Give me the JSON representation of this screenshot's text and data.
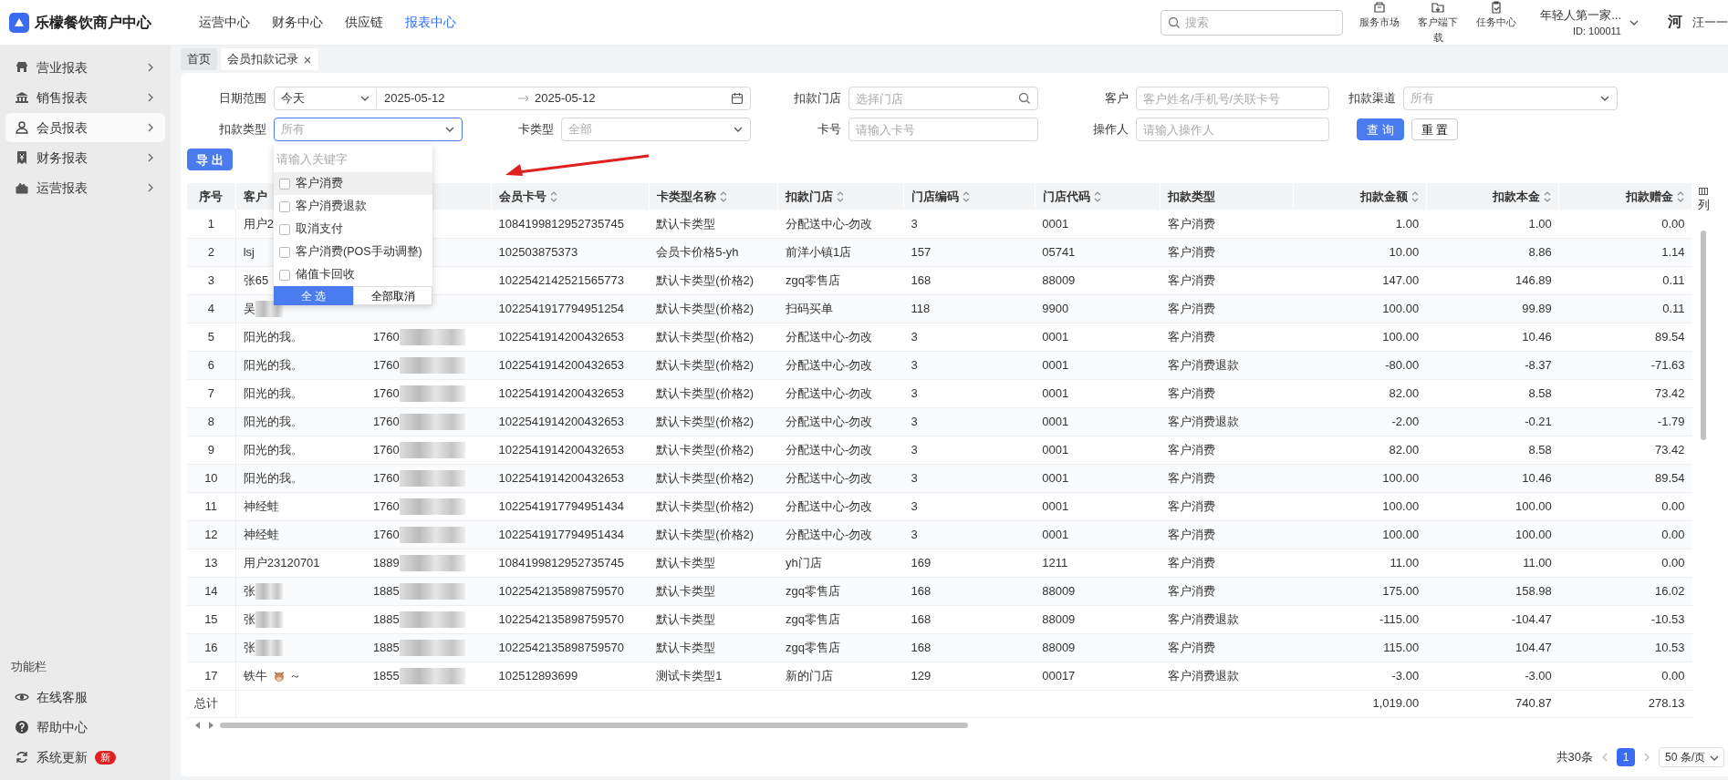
{
  "header": {
    "brand": "乐檬餐饮商户中心",
    "menu": [
      {
        "label": "运营中心",
        "selected": false
      },
      {
        "label": "财务中心",
        "selected": false
      },
      {
        "label": "供应链",
        "selected": false
      },
      {
        "label": "报表中心",
        "selected": true
      }
    ],
    "search": {
      "placeholder": "搜索"
    },
    "tools": [
      {
        "kind": "shop",
        "label": "服务市场"
      },
      {
        "kind": "download",
        "label": "客户端下载"
      },
      {
        "kind": "task",
        "label": "任务中心"
      }
    ],
    "account": {
      "name": "年轻人第一家...",
      "id": "ID: 100011"
    },
    "user": {
      "avatar": "河",
      "name": "汪一一"
    }
  },
  "sidebar": {
    "items": [
      {
        "kind": "store",
        "label": "营业报表",
        "selected": false
      },
      {
        "kind": "bank",
        "label": "销售报表",
        "selected": false
      },
      {
        "kind": "person",
        "label": "会员报表",
        "selected": true
      },
      {
        "kind": "receipt",
        "label": "财务报表",
        "selected": false
      },
      {
        "kind": "box",
        "label": "运营报表",
        "selected": false
      }
    ],
    "footer_title": "功能栏",
    "footer_items": [
      {
        "kind": "service",
        "label": "在线客服"
      },
      {
        "kind": "help",
        "label": "帮助中心"
      },
      {
        "kind": "update",
        "label": "系统更新",
        "badge": "新"
      }
    ]
  },
  "tabs": [
    {
      "label": "首页",
      "selected": false,
      "closable": false
    },
    {
      "label": "会员扣款记录",
      "selected": true,
      "closable": true
    }
  ],
  "filters": [
    {
      "kind": "date-range",
      "label": "日期范围",
      "preset": "今天",
      "start": "2025-05-12",
      "end": "2025-05-12"
    },
    {
      "kind": "search",
      "label": "扣款门店",
      "placeholder": "选择门店"
    },
    {
      "kind": "input",
      "label": "客户",
      "placeholder": "客户姓名/手机号/关联卡号"
    },
    {
      "kind": "select",
      "label": "扣款渠道",
      "placeholder": "所有",
      "open": false
    },
    {
      "kind": "select",
      "label": "扣款类型",
      "placeholder": "所有",
      "open": true
    },
    {
      "kind": "select",
      "label": "卡类型",
      "placeholder": "全部",
      "open": false
    },
    {
      "kind": "input",
      "label": "卡号",
      "placeholder": "请输入卡号"
    },
    {
      "kind": "input",
      "label": "操作人",
      "placeholder": "请输入操作人"
    }
  ],
  "query_buttons": [
    {
      "label": "查 询",
      "primary": true
    },
    {
      "label": "重 置",
      "primary": false
    }
  ],
  "dropdown": {
    "search_placeholder": "请输入关键字",
    "options": [
      {
        "label": "客户消费",
        "checked": false,
        "highlighted": true
      },
      {
        "label": "客户消费退款",
        "checked": false,
        "highlighted": false
      },
      {
        "label": "取消支付",
        "checked": false,
        "highlighted": false
      },
      {
        "label": "客户消费(POS手动调整)",
        "checked": false,
        "highlighted": false
      },
      {
        "label": "储值卡回收",
        "checked": false,
        "highlighted": false
      }
    ],
    "select_all": "全 选",
    "clear_all": "全部取消"
  },
  "export_button": "导 出",
  "table": {
    "columns": [
      {
        "label": "序号",
        "sortable": false
      },
      {
        "label": "客户",
        "sortable": false
      },
      null,
      {
        "label": "会员卡号",
        "sortable": true
      },
      {
        "label": "卡类型名称",
        "sortable": true
      },
      {
        "label": "扣款门店",
        "sortable": true
      },
      {
        "label": "门店编码",
        "sortable": true
      },
      {
        "label": "门店代码",
        "sortable": true
      },
      {
        "label": "扣款类型",
        "sortable": false
      },
      {
        "label": "扣款金额",
        "sortable": true
      },
      {
        "label": "扣款本金",
        "sortable": true
      },
      {
        "label": "扣款赠金",
        "sortable": true
      }
    ],
    "rows": [
      {
        "cells": [
          "1",
          "用户2",
          null,
          "1084199812952735745",
          "默认卡类型",
          "分配送中心-勿改",
          "3",
          "0001",
          "客户消费",
          "1.00",
          "1.00",
          "0.00"
        ]
      },
      {
        "cells": [
          "2",
          "lsj",
          null,
          "102503875373",
          "会员卡价格5-yh",
          "前洋小镇1店",
          "157",
          "05741",
          "客户消费",
          "10.00",
          "8.86",
          "1.14"
        ]
      },
      {
        "cells": [
          "3",
          "张65",
          null,
          "1022542142521565773",
          "默认卡类型(价格2)",
          "zgq零售店",
          "168",
          "88009",
          "客户消费",
          "147.00",
          "146.89",
          "0.11"
        ]
      },
      {
        "cells": [
          "4",
          "吴",
          null,
          "1022541917794951254",
          "默认卡类型(价格2)",
          "扫码买单",
          "118",
          "9900",
          "客户消费",
          "100.00",
          "99.89",
          "0.11"
        ],
        "name_blurred": true
      },
      {
        "cells": [
          "5",
          "阳光的我。",
          "1760",
          "1022541914200432653",
          "默认卡类型(价格2)",
          "分配送中心-勿改",
          "3",
          "0001",
          "客户消费",
          "100.00",
          "10.46",
          "89.54"
        ]
      },
      {
        "cells": [
          "6",
          "阳光的我。",
          "1760",
          "1022541914200432653",
          "默认卡类型(价格2)",
          "分配送中心-勿改",
          "3",
          "0001",
          "客户消费退款",
          "-80.00",
          "-8.37",
          "-71.63"
        ]
      },
      {
        "cells": [
          "7",
          "阳光的我。",
          "1760",
          "1022541914200432653",
          "默认卡类型(价格2)",
          "分配送中心-勿改",
          "3",
          "0001",
          "客户消费",
          "82.00",
          "8.58",
          "73.42"
        ]
      },
      {
        "cells": [
          "8",
          "阳光的我。",
          "1760",
          "1022541914200432653",
          "默认卡类型(价格2)",
          "分配送中心-勿改",
          "3",
          "0001",
          "客户消费退款",
          "-2.00",
          "-0.21",
          "-1.79"
        ]
      },
      {
        "cells": [
          "9",
          "阳光的我。",
          "1760",
          "1022541914200432653",
          "默认卡类型(价格2)",
          "分配送中心-勿改",
          "3",
          "0001",
          "客户消费",
          "82.00",
          "8.58",
          "73.42"
        ]
      },
      {
        "cells": [
          "10",
          "阳光的我。",
          "1760",
          "1022541914200432653",
          "默认卡类型(价格2)",
          "分配送中心-勿改",
          "3",
          "0001",
          "客户消费",
          "100.00",
          "10.46",
          "89.54"
        ]
      },
      {
        "cells": [
          "11",
          "神经蛙",
          "1760",
          "1022541917794951434",
          "默认卡类型(价格2)",
          "分配送中心-勿改",
          "3",
          "0001",
          "客户消费",
          "100.00",
          "100.00",
          "0.00"
        ]
      },
      {
        "cells": [
          "12",
          "神经蛙",
          "1760",
          "1022541917794951434",
          "默认卡类型(价格2)",
          "分配送中心-勿改",
          "3",
          "0001",
          "客户消费",
          "100.00",
          "100.00",
          "0.00"
        ]
      },
      {
        "cells": [
          "13",
          "用户23120701",
          "1889",
          "1084199812952735745",
          "默认卡类型",
          "yh门店",
          "169",
          "1211",
          "客户消费",
          "11.00",
          "11.00",
          "0.00"
        ]
      },
      {
        "cells": [
          "14",
          "张",
          "1885",
          "1022542135898759570",
          "默认卡类型",
          "zgq零售店",
          "168",
          "88009",
          "客户消费",
          "175.00",
          "158.98",
          "16.02"
        ],
        "name_blurred": true
      },
      {
        "cells": [
          "15",
          "张",
          "1885",
          "1022542135898759570",
          "默认卡类型",
          "zgq零售店",
          "168",
          "88009",
          "客户消费退款",
          "-115.00",
          "-104.47",
          "-10.53"
        ],
        "name_blurred": true
      },
      {
        "cells": [
          "16",
          "张",
          "1885",
          "1022542135898759570",
          "默认卡类型",
          "zgq零售店",
          "168",
          "88009",
          "客户消费",
          "115.00",
          "104.47",
          "10.53"
        ],
        "name_blurred": true
      },
      {
        "cells": [
          "17",
          "铁牛",
          "1855",
          "102512893699",
          "测试卡类型1",
          "新的门店",
          "129",
          "00017",
          "客户消费退款",
          "-3.00",
          "-3.00",
          "0.00"
        ],
        "name_suffix": "～"
      }
    ],
    "total": {
      "label": "总计",
      "cells": [
        "1,019.00",
        "740.87",
        "278.13"
      ]
    },
    "column_setting": "列"
  },
  "pagination": {
    "total": "共30条",
    "pages": [
      {
        "label": "1",
        "selected": true
      }
    ],
    "page_size": "50 条/页"
  }
}
